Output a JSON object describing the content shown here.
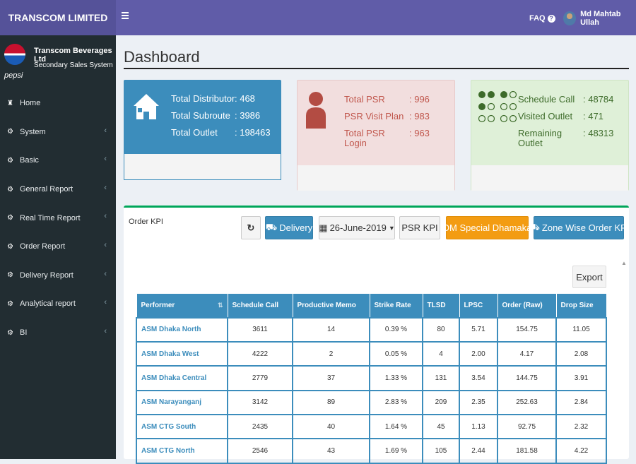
{
  "app": {
    "logo_text": "TRANSCOM LIMITED"
  },
  "topbar": {
    "faq_label": "FAQ",
    "faq_icon": "question-circle-icon",
    "user_name": "Md Mahtab Ullah"
  },
  "sidebar": {
    "brand_name": "Transcom Beverages Ltd",
    "brand_system": "Secondary Sales System",
    "brand_logo_text": "pepsi",
    "items": [
      {
        "label": "Home",
        "icon": "home-icon",
        "has_submenu": false
      },
      {
        "label": "System",
        "icon": "gear-icon",
        "has_submenu": true
      },
      {
        "label": "Basic",
        "icon": "gear-icon",
        "has_submenu": true
      },
      {
        "label": "General Report",
        "icon": "gear-icon",
        "has_submenu": true
      },
      {
        "label": "Real Time Report",
        "icon": "gear-icon",
        "has_submenu": true
      },
      {
        "label": "Order Report",
        "icon": "gear-icon",
        "has_submenu": true
      },
      {
        "label": "Delivery Report",
        "icon": "gear-icon",
        "has_submenu": true
      },
      {
        "label": "Analytical report",
        "icon": "gear-icon",
        "has_submenu": true
      },
      {
        "label": "BI",
        "icon": "gear-icon",
        "has_submenu": true
      }
    ]
  },
  "page": {
    "title": "Dashboard"
  },
  "cards": {
    "distributor": {
      "rows": [
        {
          "label": "Total Distributor",
          "value": ": 468"
        },
        {
          "label": "Total Subroute",
          "value": ": 3986"
        },
        {
          "label": "Total Outlet",
          "value": ": 198463"
        }
      ]
    },
    "psr": {
      "rows": [
        {
          "label": "Total PSR",
          "value": ": 996"
        },
        {
          "label": "PSR Visit Plan",
          "value": ": 983"
        },
        {
          "label": "Total PSR\nLogin",
          "value": ": 963"
        }
      ]
    },
    "schedule": {
      "rows": [
        {
          "label": "Schedule Call",
          "value": ": 48784"
        },
        {
          "label": "Visited Outlet",
          "value": ": 471"
        },
        {
          "label": "Remaining\nOutlet",
          "value": ": 48313"
        }
      ]
    }
  },
  "order_kpi": {
    "title": "Order KPI",
    "buttons": {
      "refresh_icon": "refresh-icon",
      "delivery": "Delivery",
      "date": "26-June-2019",
      "psr_kpi": "PSR KPI",
      "dm_special": "DM Special Dhamaka",
      "zone_wise": "Zone Wise Order KPI"
    },
    "export_label": "Export",
    "table": {
      "headers": [
        "Performer",
        "Schedule Call",
        "Productive Memo",
        "Strike Rate",
        "TLSD",
        "LPSC",
        "Order (Raw)",
        "Drop Size"
      ],
      "rows": [
        [
          "ASM Dhaka North",
          "3611",
          "14",
          "0.39 %",
          "80",
          "5.71",
          "154.75",
          "11.05"
        ],
        [
          "ASM Dhaka West",
          "4222",
          "2",
          "0.05 %",
          "4",
          "2.00",
          "4.17",
          "2.08"
        ],
        [
          "ASM Dhaka Central",
          "2779",
          "37",
          "1.33 %",
          "131",
          "3.54",
          "144.75",
          "3.91"
        ],
        [
          "ASM Narayanganj",
          "3142",
          "89",
          "2.83 %",
          "209",
          "2.35",
          "252.63",
          "2.84"
        ],
        [
          "ASM CTG South",
          "2435",
          "40",
          "1.64 %",
          "45",
          "1.13",
          "92.75",
          "2.32"
        ],
        [
          "ASM CTG North",
          "2546",
          "43",
          "1.69 %",
          "105",
          "2.44",
          "181.58",
          "4.22"
        ]
      ]
    }
  }
}
